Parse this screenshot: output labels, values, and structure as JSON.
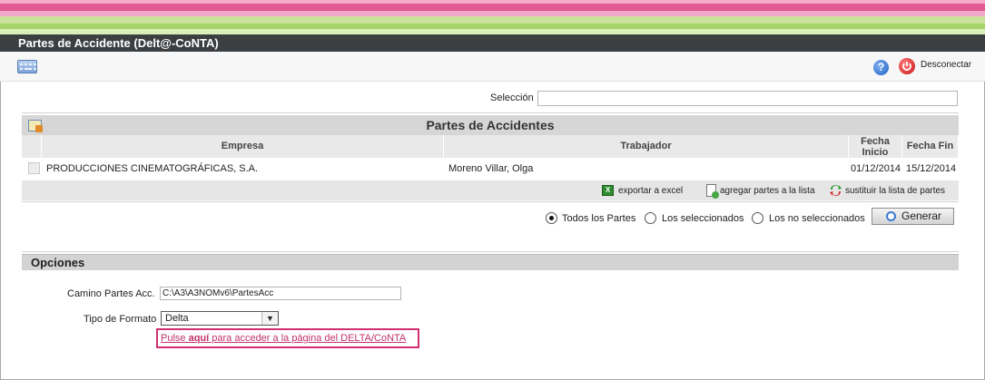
{
  "window": {
    "title": "Partes de Accidente (Delt@-CoNTA)"
  },
  "toolbar": {
    "disconnect_label": "Desconectar"
  },
  "selection": {
    "label": "Selección",
    "value": ""
  },
  "table": {
    "title": "Partes de Accidentes",
    "columns": {
      "empresa": "Empresa",
      "trabajador": "Trabajador",
      "fecha_inicio": "Fecha Inicio",
      "fecha_fin": "Fecha Fin"
    },
    "rows": [
      {
        "empresa": "PRODUCCIONES CINEMATOGRÁFICAS, S.A.",
        "trabajador": "Moreno Villar, Olga",
        "fecha_inicio": "01/12/2014",
        "fecha_fin": "15/12/2014"
      }
    ],
    "actions": {
      "export": "exportar a excel",
      "add": "agregar partes a la lista",
      "replace": "sustituir la lista de partes"
    }
  },
  "filter": {
    "options": [
      "Todos los Partes",
      "Los seleccionados",
      "Los no seleccionados"
    ],
    "selected": "Todos los Partes",
    "generate_label": "Generar"
  },
  "options": {
    "title": "Opciones",
    "path_label": "Camino Partes Acc.",
    "path_value": "C:\\A3\\A3NOMv6\\PartesAcc",
    "format_label": "Tipo de Formato",
    "format_value": "Delta",
    "link_prefix": "Pulse ",
    "link_bold": "aquí",
    "link_suffix": " para acceder a la página del DELTA/CoNTA"
  },
  "colors": {
    "title_bar": "#3c3f42",
    "accent_pink": "#e05a94",
    "accent_green": "#a6d36a",
    "link": "#c0306a"
  }
}
